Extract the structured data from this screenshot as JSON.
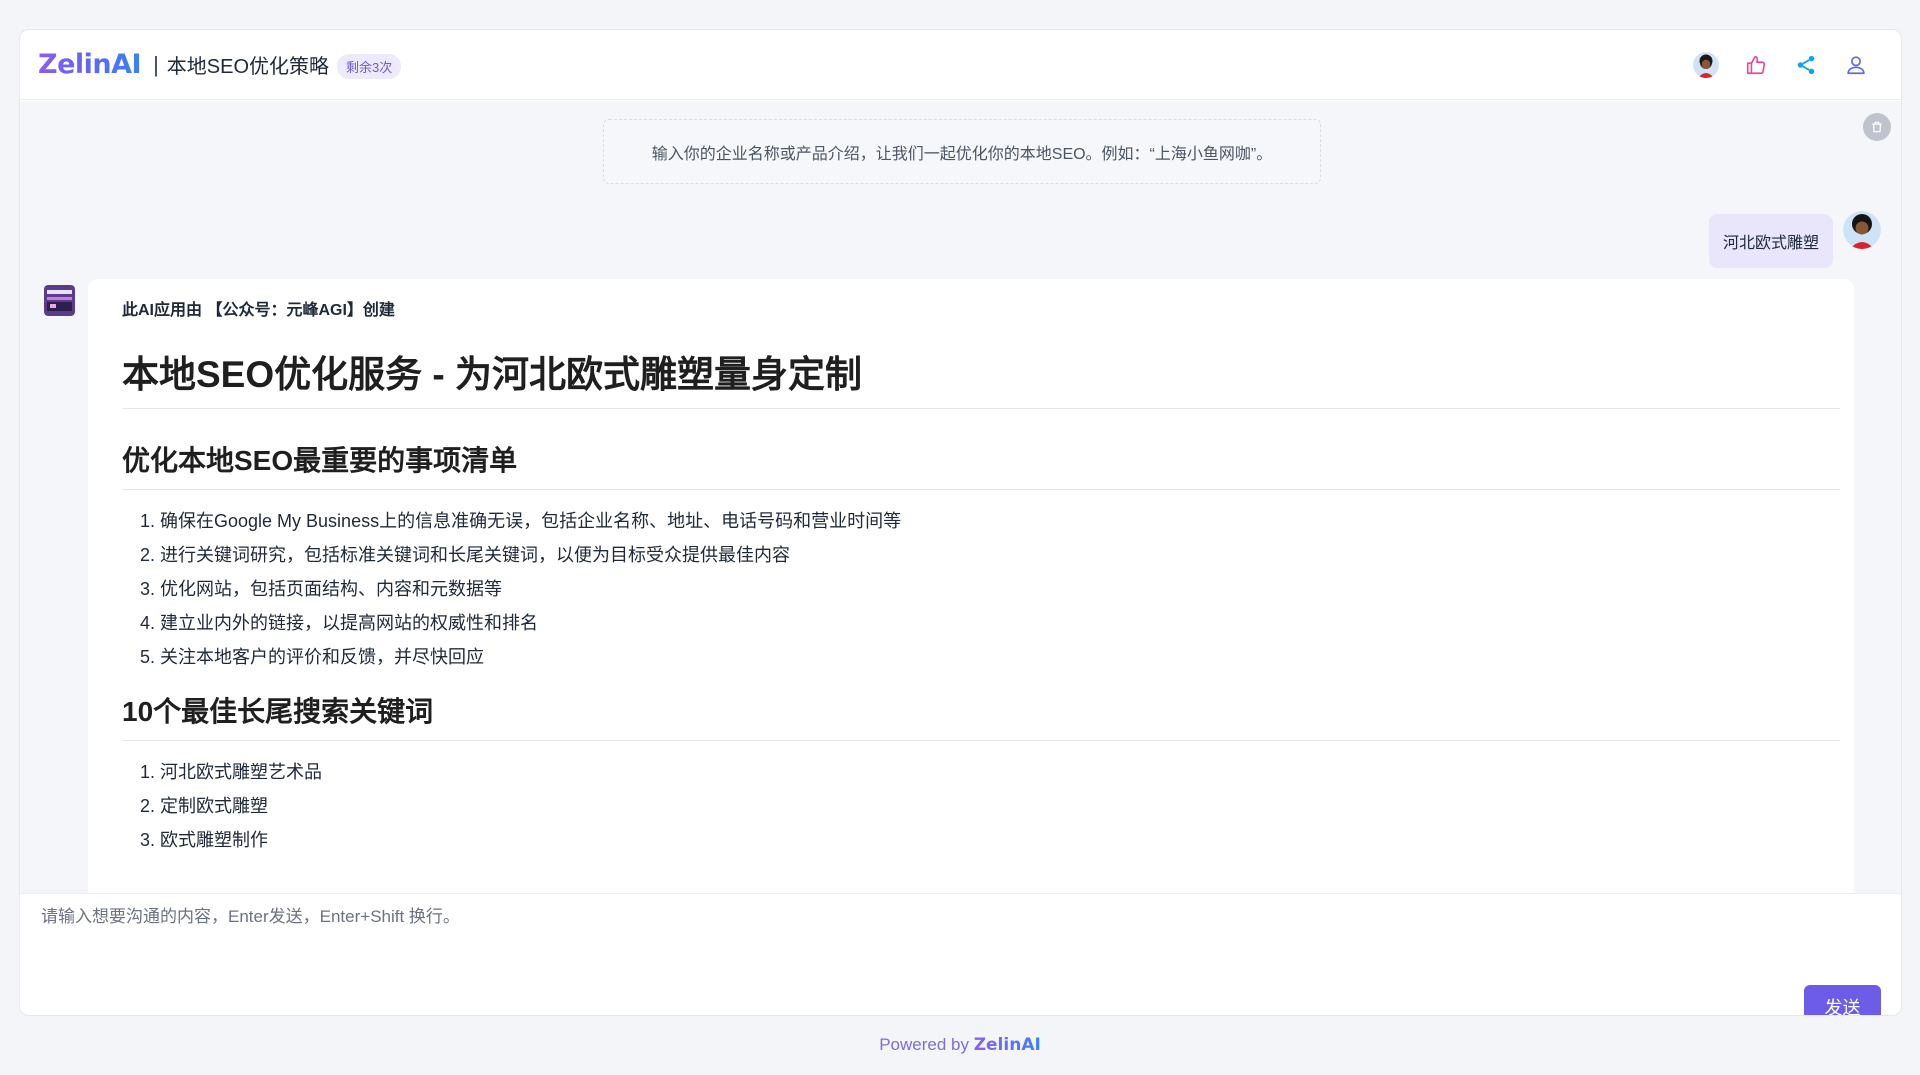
{
  "header": {
    "logo": "ZelinAI",
    "separator": "|",
    "app_title": "本地SEO优化策略",
    "remain_badge": "剩余3次",
    "actions": [
      "avatar",
      "like-icon",
      "share-icon",
      "user-icon"
    ]
  },
  "chat": {
    "hint": "输入你的企业名称或产品介绍，让我们一起优化你的本地SEO。例如：“上海小鱼网咖”。",
    "user_message": "河北欧式雕塑",
    "bot": {
      "creator": "此AI应用由 【公众号：元峰AGI】创建",
      "h1": "本地SEO优化服务 - 为河北欧式雕塑量身定制",
      "section1": {
        "heading": "优化本地SEO最重要的事项清单",
        "items": [
          "确保在Google My Business上的信息准确无误，包括企业名称、地址、电话号码和营业时间等",
          "进行关键词研究，包括标准关键词和长尾关键词，以便为目标受众提供最佳内容",
          "优化网站，包括页面结构、内容和元数据等",
          "建立业内外的链接，以提高网站的权威性和排名",
          "关注本地客户的评价和反馈，并尽快回应"
        ]
      },
      "section2": {
        "heading": "10个最佳长尾搜索关键词",
        "items": [
          "河北欧式雕塑艺术品",
          "定制欧式雕塑",
          "欧式雕塑制作"
        ]
      }
    }
  },
  "input": {
    "placeholder": "请输入想要沟通的内容，Enter发送，Enter+Shift 换行。",
    "send_label": "发送"
  },
  "footer": {
    "powered_by": "Powered by",
    "brand": "ZelinAI"
  },
  "colors": {
    "accent": "#6c5ce7",
    "badge_bg": "#eeeafd",
    "user_bubble": "#e9e6fb"
  }
}
